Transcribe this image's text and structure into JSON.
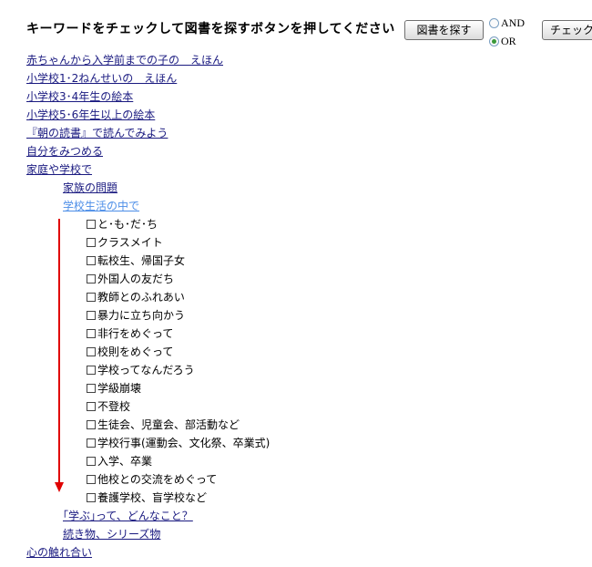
{
  "header": {
    "title": "キーワードをチェックして図書を探すボタンを押してください",
    "search_button": "図書を探す",
    "check_button": "チェック",
    "radio_and": "AND",
    "radio_or": "OR",
    "selected_operator": "OR"
  },
  "tree": {
    "top_links": [
      "赤ちゃんから入学前までの子の　えほん",
      "小学校1･2ねんせいの　えほん",
      "小学校3･4年生の絵本",
      "小学校5･6年生以上の絵本",
      "『朝の読書』で読んでみよう",
      "自分をみつめる",
      "家庭や学校で"
    ],
    "family_problem": "家族の問題",
    "school_life": "学校生活の中で",
    "keywords": [
      "と･も･だ･ち",
      "クラスメイト",
      "転校生、帰国子女",
      "外国人の友だち",
      "教師とのふれあい",
      "暴力に立ち向かう",
      "非行をめぐって",
      "校則をめぐって",
      "学校ってなんだろう",
      "学級崩壊",
      "不登校",
      "生徒会、児童会、部活動など",
      "学校行事(運動会、文化祭、卒業式)",
      "入学、卒業",
      "他校との交流をめぐって",
      "養護学校、盲学校など"
    ],
    "learning": "｢学ぶ｣って、どんなこと？",
    "series": "続き物、シリーズ物",
    "heart": "心の触れ合い"
  },
  "colors": {
    "link": "#1a1a80",
    "visited_link": "#4c8ee8",
    "arrow": "#e00000",
    "radio_selected": "#3a9a3a"
  }
}
